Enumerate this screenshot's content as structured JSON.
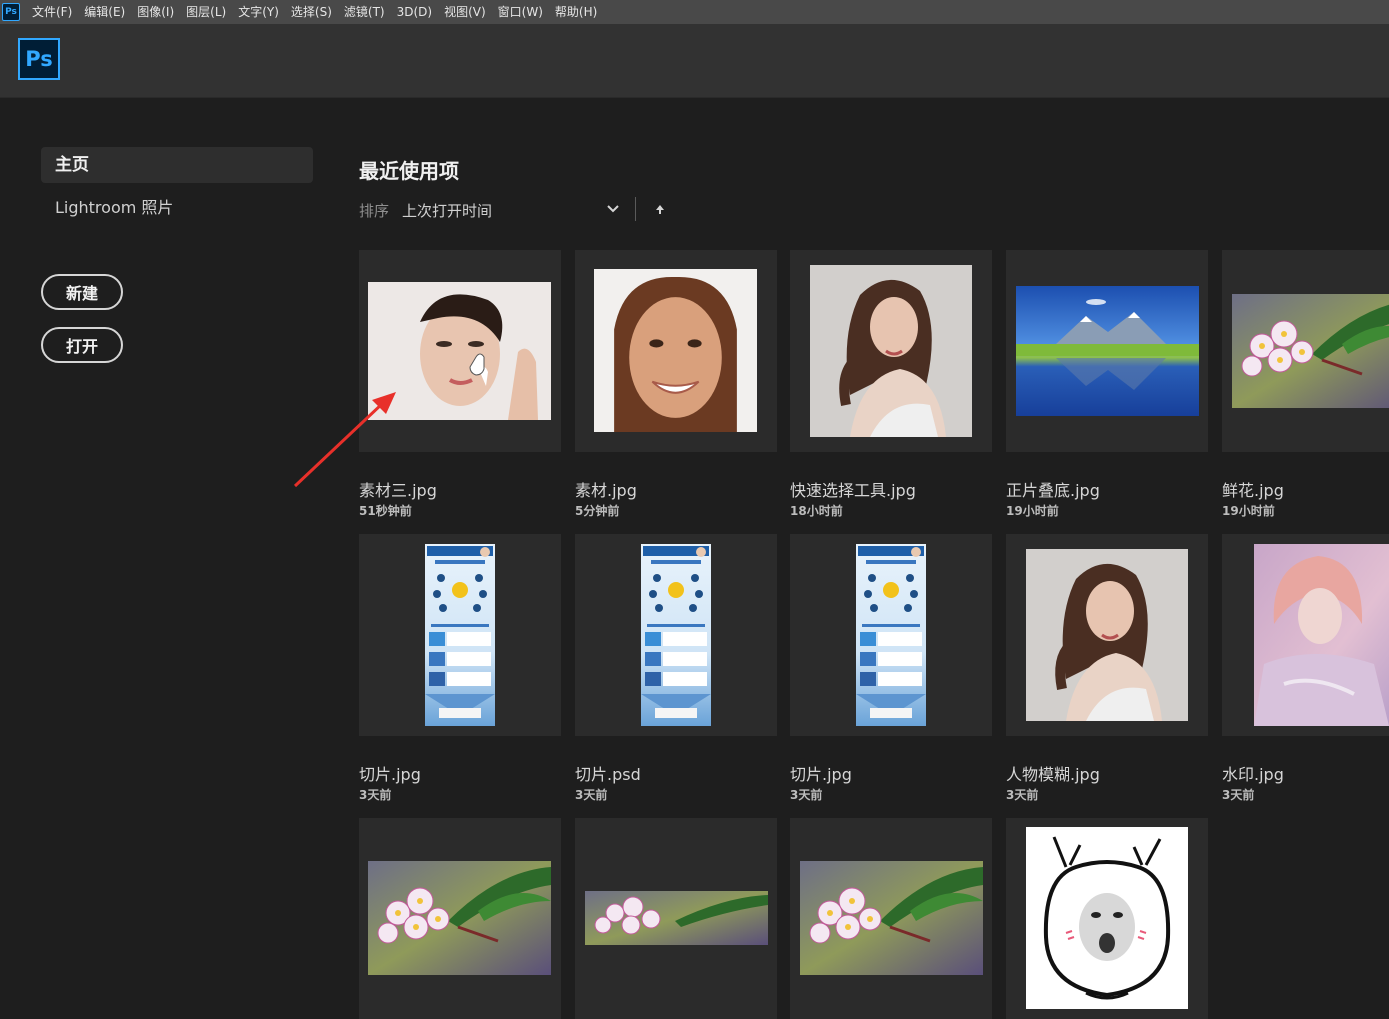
{
  "menubar": {
    "app_icon_label": "Ps",
    "items": [
      "文件(F)",
      "编辑(E)",
      "图像(I)",
      "图层(L)",
      "文字(Y)",
      "选择(S)",
      "滤镜(T)",
      "3D(D)",
      "视图(V)",
      "窗口(W)",
      "帮助(H)"
    ]
  },
  "header": {
    "logo_text": "Ps"
  },
  "sidebar": {
    "home_label": "主页",
    "lightroom_label": "Lightroom 照片",
    "new_button": "新建",
    "open_button": "打开"
  },
  "recent": {
    "title": "最近使用项",
    "sort_label": "排序",
    "sort_value": "上次打开时间",
    "files": [
      {
        "name": "素材三.jpg",
        "time": "51秒钟前",
        "thumb": "portrait-hand"
      },
      {
        "name": "素材.jpg",
        "time": "5分钟前",
        "thumb": "portrait-smile"
      },
      {
        "name": "快速选择工具.jpg",
        "time": "18小时前",
        "thumb": "portrait-curly"
      },
      {
        "name": "正片叠底.jpg",
        "time": "19小时前",
        "thumb": "landscape-lake"
      },
      {
        "name": "鲜花.jpg",
        "time": "19小时前",
        "thumb": "flower"
      },
      {
        "name": "切片.jpg",
        "time": "3天前",
        "thumb": "infographic"
      },
      {
        "name": "切片.psd",
        "time": "3天前",
        "thumb": "infographic"
      },
      {
        "name": "切片.jpg",
        "time": "3天前",
        "thumb": "infographic"
      },
      {
        "name": "人物模糊.jpg",
        "time": "3天前",
        "thumb": "portrait-curly"
      },
      {
        "name": "水印.jpg",
        "time": "3天前",
        "thumb": "portrait-pastel"
      },
      {
        "name": "",
        "time": "",
        "thumb": "flower"
      },
      {
        "name": "",
        "time": "",
        "thumb": "flower-wide"
      },
      {
        "name": "",
        "time": "",
        "thumb": "flower"
      },
      {
        "name": "",
        "time": "",
        "thumb": "cartoon-cat"
      }
    ]
  },
  "colors": {
    "accent": "#31a8ff",
    "annotation_arrow": "#e8302a",
    "background": "#1e1e1e"
  }
}
